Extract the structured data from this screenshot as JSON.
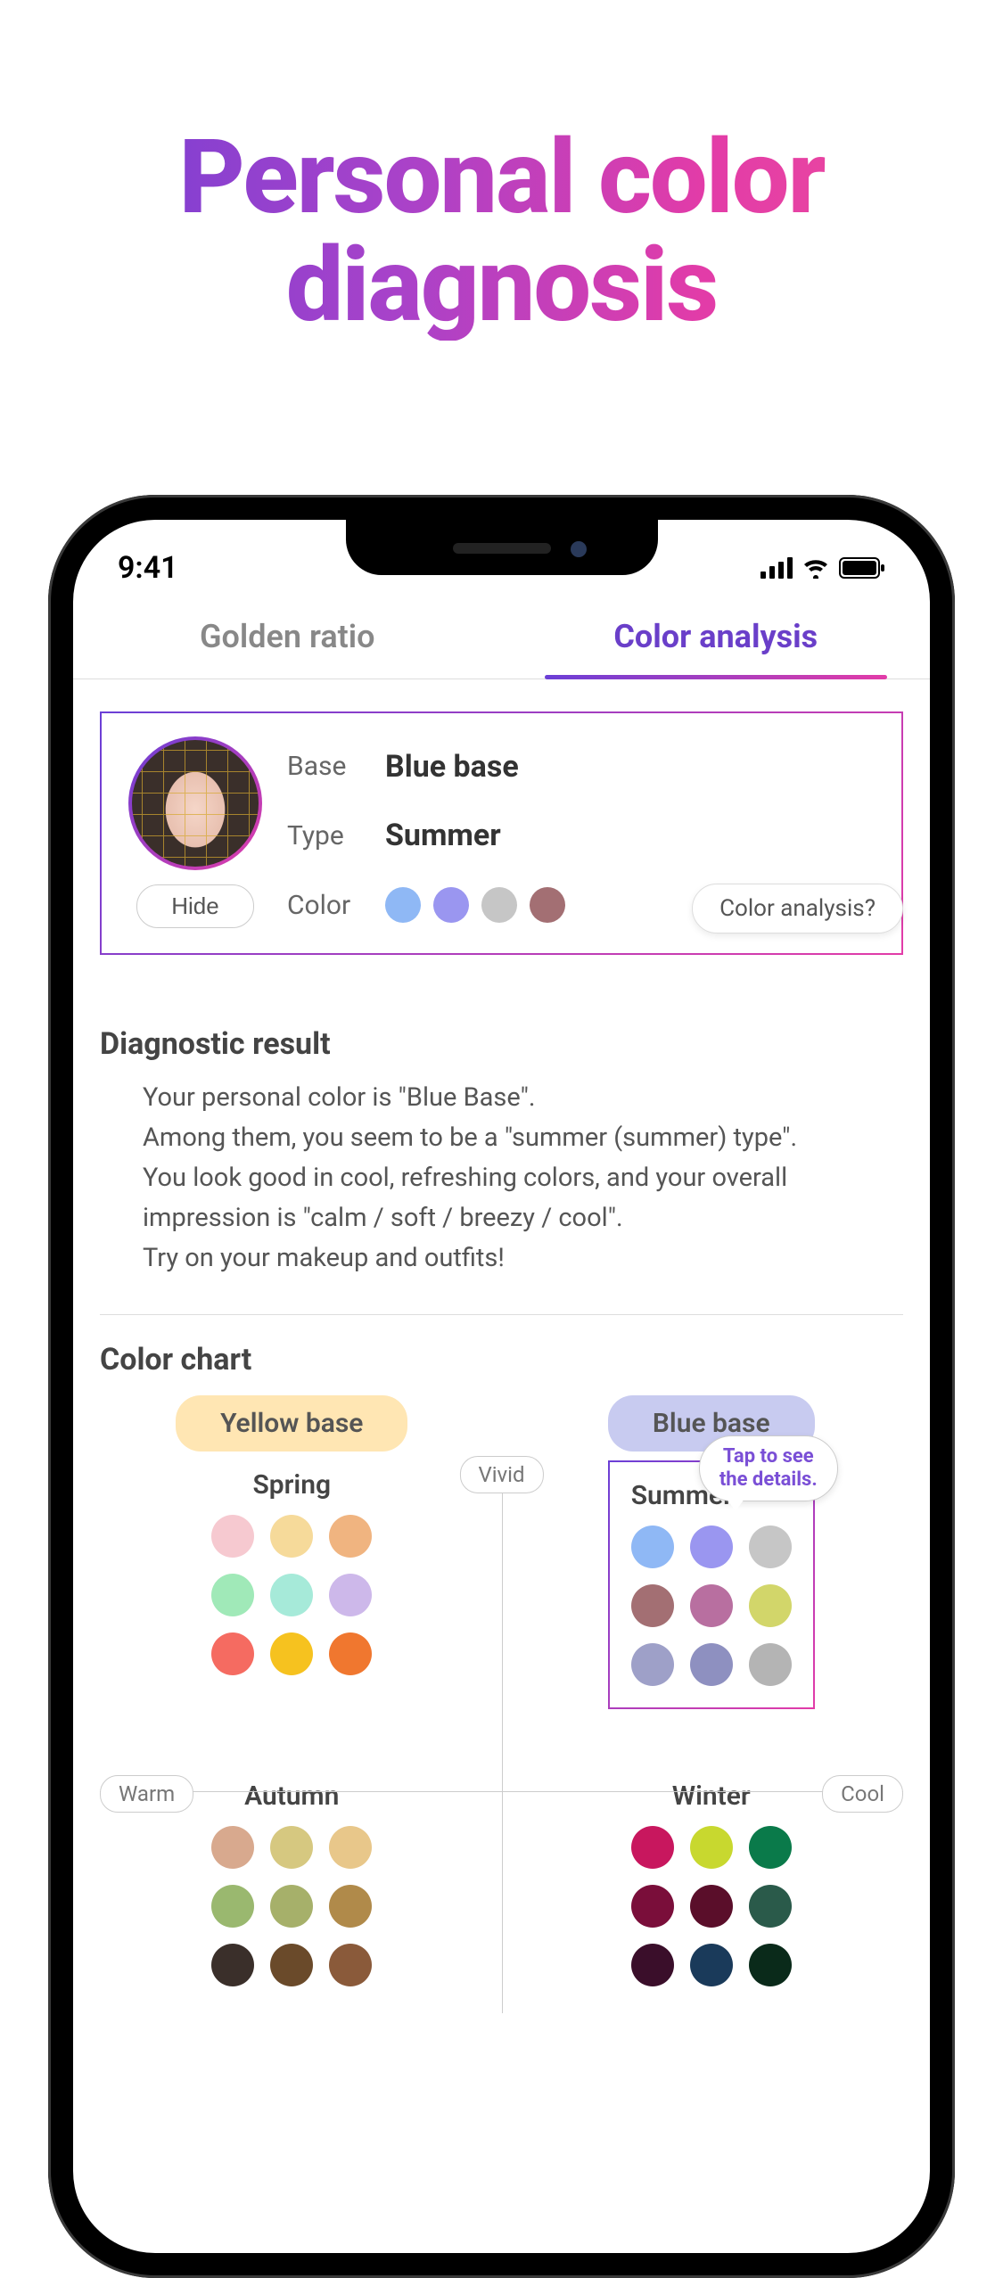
{
  "hero": {
    "line1": "Personal color",
    "line2": "diagnosis"
  },
  "status": {
    "time": "9:41"
  },
  "tabs": {
    "golden_ratio": "Golden ratio",
    "color_analysis": "Color analysis"
  },
  "summary": {
    "hide_label": "Hide",
    "labels": {
      "base": "Base",
      "type": "Type",
      "color": "Color"
    },
    "values": {
      "base": "Blue base",
      "type": "Summer"
    },
    "swatches": [
      "#8fb8f5",
      "#9a96f0",
      "#c6c6c6",
      "#a36f73"
    ]
  },
  "help_pill": "Color analysis?",
  "diagnostic": {
    "title": "Diagnostic result",
    "p1": "Your personal color is \"Blue Base\".",
    "p2": "Among them, you seem to be a \"summer (summer) type\".",
    "p3": "You look good in cool, refreshing colors, and your overall impression is \"calm / soft / breezy / cool\".",
    "p4": "Try on your makeup and outfits!"
  },
  "chart": {
    "title": "Color chart",
    "yellow_base": "Yellow base",
    "blue_base": "Blue base",
    "axis": {
      "vivid": "Vivid",
      "warm": "Warm",
      "cool": "Cool"
    },
    "tooltip": "Tap to see\nthe details.",
    "seasons": {
      "spring": {
        "label": "Spring",
        "colors": [
          "#f6c9d0",
          "#f6da9a",
          "#f0b480",
          "#a0e9b8",
          "#a6ead9",
          "#cdb8ea",
          "#f56b61",
          "#f6c21f",
          "#f0772f"
        ]
      },
      "summer": {
        "label": "Summer",
        "colors": [
          "#8fb8f5",
          "#9a96f0",
          "#c6c6c6",
          "#a36f73",
          "#b86fa0",
          "#d2d66a",
          "#9ea0c8",
          "#8e90c0",
          "#b4b4b4"
        ]
      },
      "autumn": {
        "label": "Autumn",
        "colors": [
          "#d8a98e",
          "#d6c880",
          "#e8c78a",
          "#9ab86f",
          "#a6b06a",
          "#b08a4a",
          "#3a2f2a",
          "#6a4a2a",
          "#8a5a3a"
        ]
      },
      "winter": {
        "label": "Winter",
        "colors": [
          "#c8175e",
          "#c8d82f",
          "#0a7a4a",
          "#7a0e3a",
          "#5a0e2a",
          "#2a5a4a",
          "#3a0e2a",
          "#1a3a5a",
          "#0a2a1a"
        ]
      }
    }
  }
}
